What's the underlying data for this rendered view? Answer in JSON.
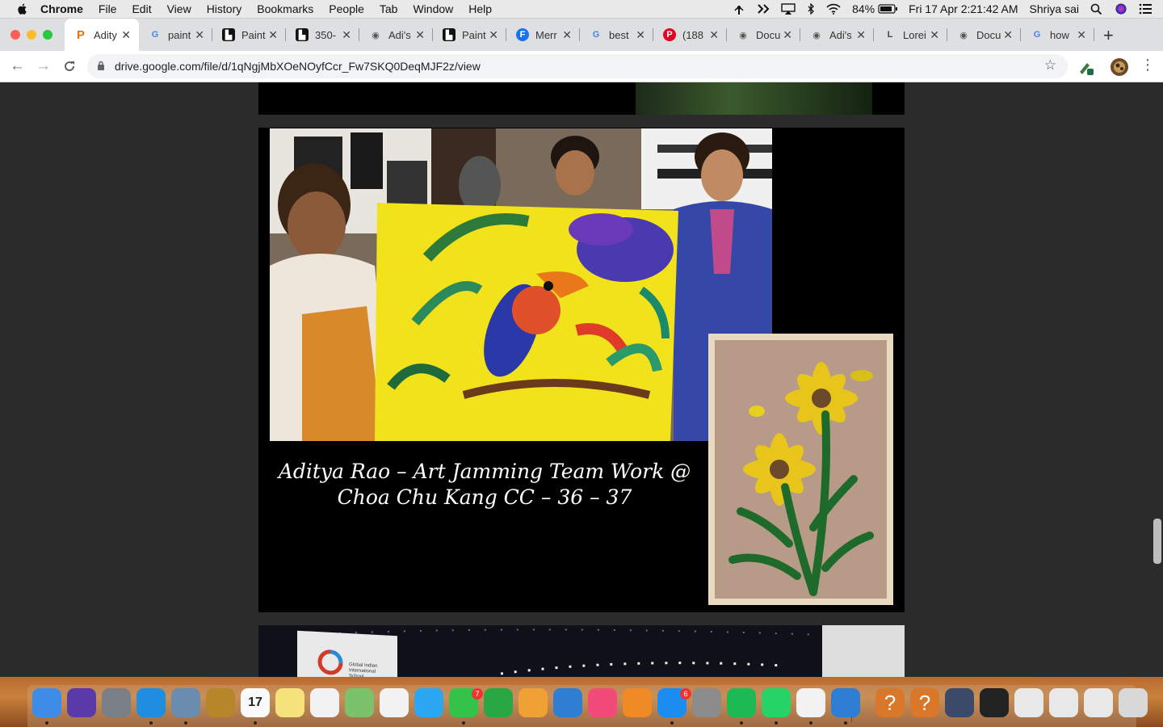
{
  "menubar": {
    "items": [
      "Chrome",
      "File",
      "Edit",
      "View",
      "History",
      "Bookmarks",
      "People",
      "Tab",
      "Window",
      "Help"
    ],
    "battery": "84%",
    "clock": "Fri 17 Apr  2:21:42 AM",
    "user": "Shriya sai"
  },
  "tabs": [
    {
      "title": "Adity",
      "icon": "p-icon",
      "color": "#e8710a",
      "active": true
    },
    {
      "title": "paint",
      "icon": "google-icon",
      "color": "#4285f4"
    },
    {
      "title": "Paint",
      "icon": "drive-icon",
      "color": "#111111"
    },
    {
      "title": "350-",
      "icon": "drive-icon",
      "color": "#111111"
    },
    {
      "title": "Adi's",
      "icon": "globe-icon",
      "color": "#555555"
    },
    {
      "title": "Paint",
      "icon": "drive-icon",
      "color": "#111111"
    },
    {
      "title": "Merr",
      "icon": "f-icon",
      "color": "#1a73e8"
    },
    {
      "title": "best",
      "icon": "google-icon",
      "color": "#4285f4"
    },
    {
      "title": "(188",
      "icon": "pinterest-icon",
      "color": "#e60023"
    },
    {
      "title": "Docu",
      "icon": "globe-icon",
      "color": "#555555"
    },
    {
      "title": "Adi's",
      "icon": "globe-icon",
      "color": "#555555"
    },
    {
      "title": "Lorei",
      "icon": "l-icon",
      "color": "#444444"
    },
    {
      "title": "Docu",
      "icon": "globe-icon",
      "color": "#555555"
    },
    {
      "title": "how",
      "icon": "google-icon",
      "color": "#4285f4"
    }
  ],
  "toolbar": {
    "url": "drive.google.com/file/d/1qNgjMbXOeNOyfCcr_Fw7SKQ0DeqMJF2z/view"
  },
  "document": {
    "caption_line1": "Aditya Rao – Art Jamming Team Work @",
    "caption_line2": "Choa Chu Kang CC – 36 – 37",
    "school_sign": "Global Indian International School"
  },
  "dock": {
    "apps": [
      {
        "name": "finder-icon",
        "color": "#3d8de8"
      },
      {
        "name": "siri-icon",
        "color": "#5a3aa8"
      },
      {
        "name": "launchpad-icon",
        "color": "#7a7f86"
      },
      {
        "name": "safari-icon",
        "color": "#1f8de0"
      },
      {
        "name": "preview-icon",
        "color": "#6a8cae"
      },
      {
        "name": "notes-brown-icon",
        "color": "#b8862a"
      },
      {
        "name": "calendar-icon",
        "color": "#fafafa",
        "label": "17"
      },
      {
        "name": "notes-icon",
        "color": "#f5e27a"
      },
      {
        "name": "reminders-icon",
        "color": "#f2f2f2"
      },
      {
        "name": "maps-icon",
        "color": "#7cc26a"
      },
      {
        "name": "photos-icon",
        "color": "#f2f2f2"
      },
      {
        "name": "messages-icon",
        "color": "#2ba6f0"
      },
      {
        "name": "facetime-icon",
        "color": "#33c24a",
        "badge": "7"
      },
      {
        "name": "numbers-icon",
        "color": "#2aa745"
      },
      {
        "name": "pages-icon",
        "color": "#f0a136"
      },
      {
        "name": "keynote-icon",
        "color": "#2e7ed3"
      },
      {
        "name": "itunes-icon",
        "color": "#f24b7a"
      },
      {
        "name": "books-icon",
        "color": "#f08a24"
      },
      {
        "name": "app-store-icon",
        "color": "#1b8cf0",
        "badge": "6"
      },
      {
        "name": "system-preferences-icon",
        "color": "#8c8c8c"
      },
      {
        "name": "spotify-icon",
        "color": "#1db954"
      },
      {
        "name": "whatsapp-icon",
        "color": "#25d366"
      },
      {
        "name": "chrome-icon",
        "color": "#f2f2f2"
      },
      {
        "name": "vscode-icon",
        "color": "#2d7dd2"
      },
      {
        "name": "unknown-app-icon",
        "color": "#d9772a",
        "label": "?"
      },
      {
        "name": "unknown-app-icon",
        "color": "#d9772a",
        "label": "?"
      },
      {
        "name": "screenshot-window-icon",
        "color": "#3c4a6a"
      },
      {
        "name": "terminal-window-icon",
        "color": "#222222"
      },
      {
        "name": "document-window-icon",
        "color": "#e8e8e8"
      },
      {
        "name": "document-window-icon",
        "color": "#e8e8e8"
      },
      {
        "name": "document-window-icon",
        "color": "#e8e8e8"
      },
      {
        "name": "trash-icon",
        "color": "#d8d8d8"
      }
    ]
  }
}
